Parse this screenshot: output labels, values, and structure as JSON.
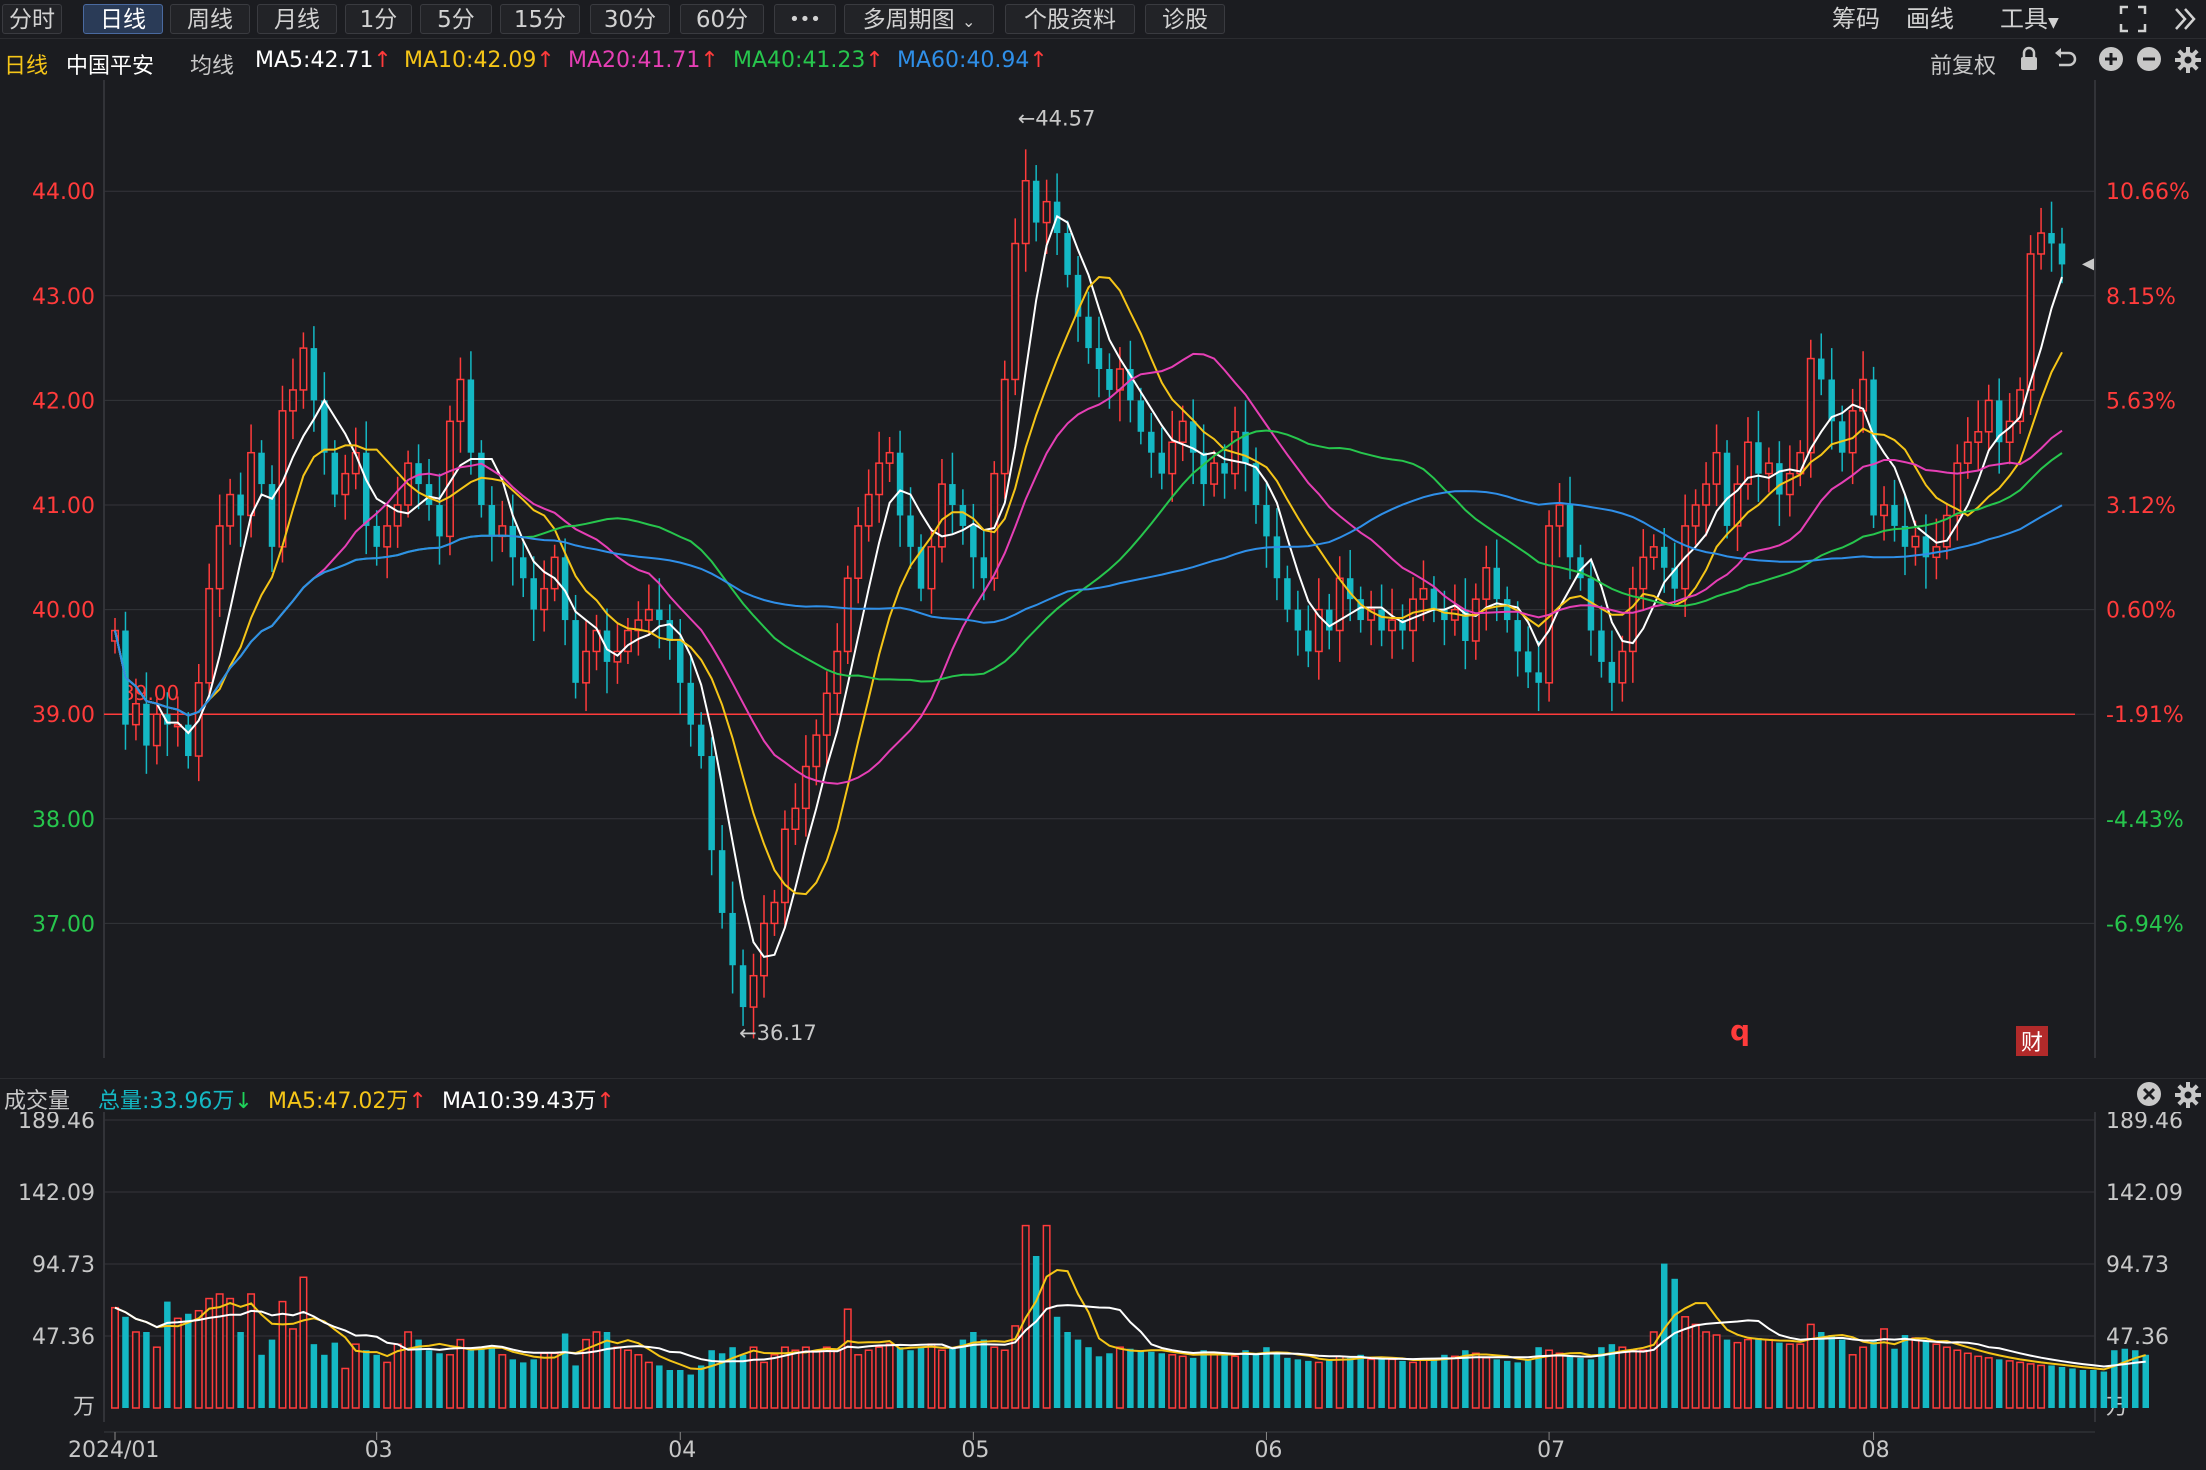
{
  "toolbar": {
    "tabs": [
      {
        "label": "分时",
        "active": false
      },
      {
        "label": "日线",
        "active": true
      },
      {
        "label": "周线",
        "active": false
      },
      {
        "label": "月线",
        "active": false
      },
      {
        "label": "1分",
        "active": false
      },
      {
        "label": "5分",
        "active": false
      },
      {
        "label": "15分",
        "active": false
      },
      {
        "label": "30分",
        "active": false
      },
      {
        "label": "60分",
        "active": false
      },
      {
        "label": "•••",
        "active": false
      },
      {
        "label": "多周期图",
        "active": false
      },
      {
        "label": "个股资料",
        "active": false
      },
      {
        "label": "诊股",
        "active": false
      }
    ],
    "right": {
      "chips": "筹码",
      "draw": "画线",
      "tools": "工具"
    }
  },
  "legend": {
    "period": "日线",
    "stock": "中国平安",
    "ma_label": "均线",
    "ma5": "MA5:42.71",
    "ma10": "MA10:42.09",
    "ma20": "MA20:41.71",
    "ma40": "MA40:41.23",
    "ma60": "MA60:40.94",
    "adjust": "前复权"
  },
  "volume_legend": {
    "title": "成交量",
    "total": "总量:33.96万",
    "ma5": "MA5:47.02万",
    "ma10": "MA10:39.43万"
  },
  "colors": {
    "up": "#ff3b3b",
    "down": "#14b8c4",
    "ma5": "#ffffff",
    "ma10": "#f5c518",
    "ma20": "#e63fb5",
    "ma40": "#27c64d",
    "ma60": "#2f8fe8",
    "grid": "#34353a",
    "ref_line": "#ff3b3b"
  },
  "chart_data": [
    {
      "type": "candlestick",
      "title": "中国平安 日线",
      "ylim": [
        36.0,
        44.8
      ],
      "yticks": [
        37.0,
        38.0,
        39.0,
        40.0,
        41.0,
        42.0,
        43.0,
        44.0
      ],
      "ytick_labels": [
        "37.00",
        "38.00",
        "39.00",
        "40.00",
        "41.00",
        "42.00",
        "43.00",
        "44.00"
      ],
      "pct_ticks": [
        "-6.94%",
        "-4.43%",
        "-1.91%",
        "0.60%",
        "3.12%",
        "5.63%",
        "8.15%",
        "10.66%"
      ],
      "reference_price": 39.0,
      "reference_label": "39.00",
      "annotations": {
        "high": "←44.57",
        "low": "←36.17",
        "high_value": 44.57,
        "low_value": 36.17
      },
      "markers": {
        "q": "q",
        "fin": "财"
      },
      "month_labels": [
        {
          "label": "2024/01",
          "index": 0
        },
        {
          "label": "03",
          "index": 25
        },
        {
          "label": "04",
          "index": 54
        },
        {
          "label": "05",
          "index": 82
        },
        {
          "label": "06",
          "index": 110
        },
        {
          "label": "07",
          "index": 137
        },
        {
          "label": "08",
          "index": 168
        }
      ],
      "closes": [
        39.8,
        38.9,
        39.1,
        38.7,
        39.0,
        38.9,
        38.9,
        38.6,
        39.3,
        40.2,
        40.8,
        41.1,
        40.9,
        41.5,
        41.2,
        40.6,
        41.9,
        42.1,
        42.5,
        42.0,
        41.5,
        41.1,
        41.3,
        41.5,
        40.8,
        40.6,
        40.8,
        41.0,
        41.4,
        41.2,
        41.0,
        40.7,
        41.8,
        42.2,
        41.5,
        41.0,
        40.7,
        40.8,
        40.5,
        40.3,
        40.0,
        40.2,
        40.5,
        39.9,
        39.3,
        39.6,
        39.8,
        39.5,
        39.6,
        39.8,
        39.9,
        40.0,
        39.9,
        39.7,
        39.3,
        38.9,
        38.6,
        37.7,
        37.1,
        36.6,
        36.2,
        36.5,
        37.0,
        37.2,
        37.9,
        38.1,
        38.5,
        38.8,
        39.2,
        39.6,
        40.3,
        40.8,
        41.1,
        41.4,
        41.5,
        40.9,
        40.6,
        40.2,
        40.6,
        41.2,
        41.0,
        40.8,
        40.5,
        40.3,
        41.3,
        42.2,
        43.5,
        44.1,
        43.7,
        43.9,
        43.6,
        43.2,
        42.8,
        42.5,
        42.3,
        42.1,
        42.3,
        42.0,
        41.7,
        41.5,
        41.3,
        41.6,
        41.8,
        41.5,
        41.2,
        41.4,
        41.3,
        41.7,
        41.4,
        41.0,
        40.7,
        40.3,
        40.0,
        39.8,
        39.6,
        40.0,
        39.8,
        40.3,
        40.1,
        39.9,
        40.0,
        39.8,
        39.9,
        39.8,
        40.1,
        40.2,
        40.0,
        39.9,
        40.0,
        39.7,
        40.1,
        40.4,
        40.1,
        39.9,
        39.6,
        39.4,
        39.3,
        40.8,
        41.0,
        40.5,
        40.3,
        39.8,
        39.5,
        39.3,
        39.6,
        40.2,
        40.5,
        40.6,
        40.4,
        40.2,
        40.8,
        41.0,
        41.2,
        41.5,
        40.8,
        41.2,
        41.6,
        41.3,
        41.4,
        41.1,
        41.3,
        41.5,
        42.4,
        42.2,
        41.8,
        41.5,
        41.9,
        42.2,
        40.9,
        41.0,
        40.8,
        40.6,
        40.7,
        40.5,
        40.6,
        40.9,
        41.4,
        41.6,
        41.7,
        42.0,
        41.6,
        41.8,
        42.1,
        43.4,
        43.6,
        43.5,
        43.3
      ]
    },
    {
      "type": "bar",
      "title": "成交量",
      "unit": "万",
      "ylim": [
        0,
        189.46
      ],
      "yticks": [
        47.36,
        94.73,
        142.09,
        189.46
      ],
      "ytick_labels": [
        "47.36",
        "94.73",
        "142.09",
        "189.46"
      ],
      "values": [
        66,
        60,
        50,
        50,
        40,
        70,
        59,
        62,
        64,
        72,
        75,
        72,
        50,
        75,
        35,
        45,
        70,
        52,
        86,
        42,
        35,
        43,
        26,
        42,
        38,
        35,
        30,
        42,
        50,
        45,
        38,
        36,
        35,
        45,
        38,
        40,
        40,
        35,
        32,
        30,
        32,
        36,
        36,
        49,
        28,
        45,
        50,
        50,
        40,
        38,
        35,
        30,
        28,
        25,
        25,
        22,
        28,
        38,
        36,
        40,
        35,
        40,
        30,
        35,
        40,
        38,
        40,
        37,
        40,
        38,
        65,
        35,
        38,
        40,
        42,
        40,
        38,
        40,
        42,
        38,
        40,
        45,
        50,
        45,
        40,
        38,
        54,
        120,
        100,
        120,
        60,
        50,
        45,
        40,
        34,
        36,
        40,
        39,
        38,
        37,
        36,
        35,
        34,
        33,
        38,
        36,
        35,
        34,
        38,
        35,
        40,
        36,
        33,
        32,
        31,
        30,
        32,
        34,
        33,
        35,
        32,
        33,
        32,
        31,
        30,
        32,
        33,
        35,
        34,
        38,
        36,
        33,
        32,
        31,
        30,
        32,
        40,
        38,
        36,
        34,
        33,
        32,
        40,
        42,
        40,
        38,
        38,
        50,
        95,
        85,
        60,
        55,
        50,
        48,
        45,
        43,
        45,
        46,
        45,
        43,
        42,
        42,
        55,
        50,
        48,
        45,
        35,
        40,
        44,
        52,
        39,
        48,
        46,
        44,
        42,
        40,
        38,
        36,
        34,
        33,
        32,
        31,
        30,
        29,
        28,
        28,
        27,
        26,
        25,
        25,
        24,
        38,
        39,
        38,
        35
      ]
    }
  ]
}
